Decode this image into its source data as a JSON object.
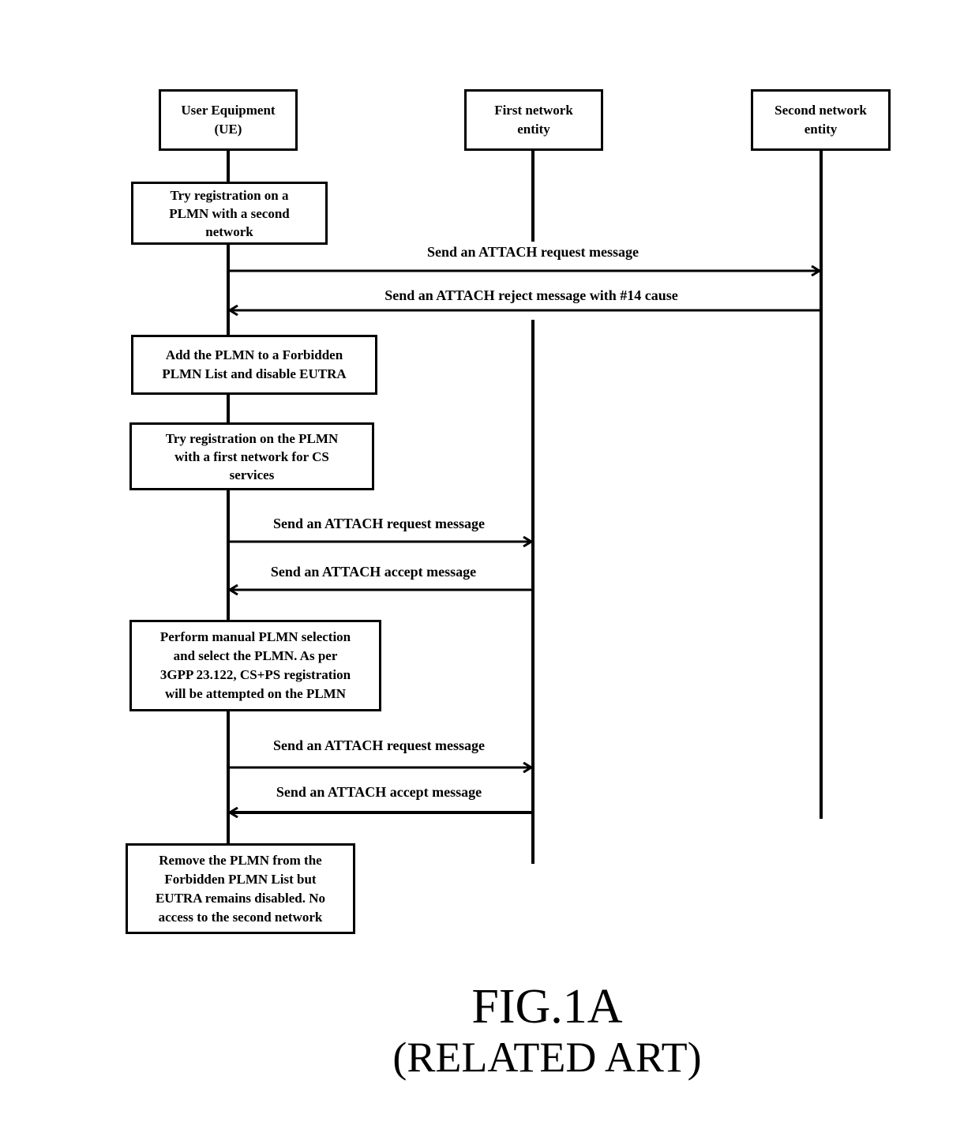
{
  "entities": [
    {
      "label": "User Equipment\n(UE)"
    },
    {
      "label": "First network\nentity"
    },
    {
      "label": "Second network\nentity"
    }
  ],
  "steps": [
    {
      "text": "Try registration on a\nPLMN with a second\nnetwork"
    },
    {
      "text": "Add the PLMN to a Forbidden\nPLMN List and disable EUTRA"
    },
    {
      "text": "Try registration on the PLMN\nwith a first network for CS\nservices"
    },
    {
      "text": "Perform manual PLMN selection\nand select  the PLMN. As per\n3GPP 23.122, CS+PS registration\nwill be attempted on the PLMN"
    },
    {
      "text": "Remove the PLMN from the\nForbidden PLMN List but\nEUTRA remains disabled. No\naccess to the second network"
    }
  ],
  "messages": [
    {
      "text": "Send an ATTACH request message",
      "from": "UE",
      "to": "Second network entity"
    },
    {
      "text": "Send an ATTACH reject message with #14 cause",
      "from": "Second network entity",
      "to": "UE"
    },
    {
      "text": "Send an ATTACH request message",
      "from": "UE",
      "to": "First network entity"
    },
    {
      "text": "Send an ATTACH accept message",
      "from": "First network entity",
      "to": "UE"
    },
    {
      "text": "Send an ATTACH request message",
      "from": "UE",
      "to": "First network entity"
    },
    {
      "text": "Send an ATTACH accept message",
      "from": "First network entity",
      "to": "UE"
    }
  ],
  "figure": {
    "title": "FIG.1A",
    "subtitle": "(RELATED ART)"
  }
}
